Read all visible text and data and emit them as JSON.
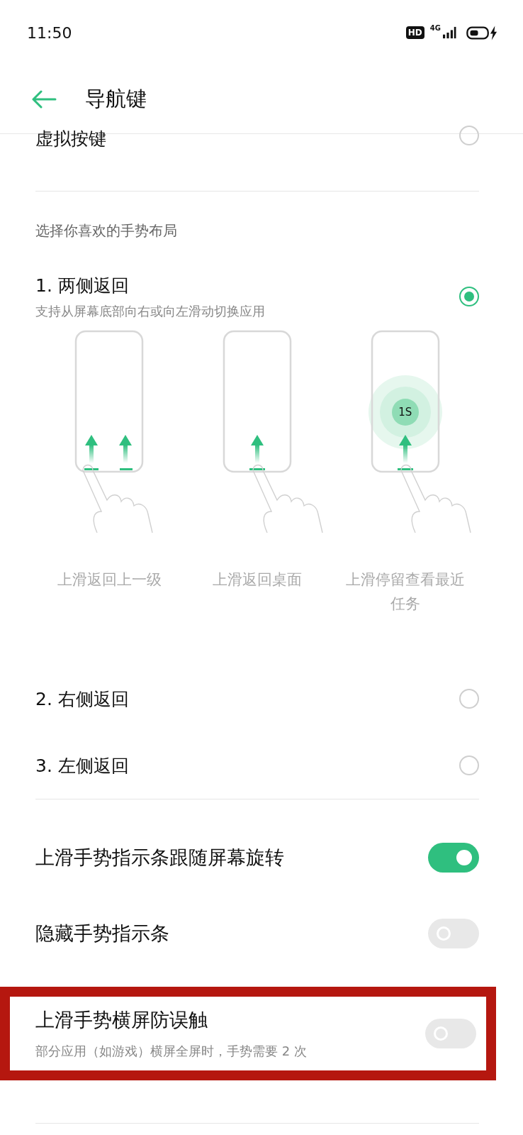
{
  "status_bar": {
    "time": "11:50",
    "hd": "HD",
    "network": "4G"
  },
  "header": {
    "title": "导航键"
  },
  "top_option": {
    "label": "虚拟按键",
    "selected": false
  },
  "section_label": "选择你喜欢的手势布局",
  "layouts": [
    {
      "label": "1. 两侧返回",
      "description": "支持从屏幕底部向右或向左滑动切换应用",
      "selected": true
    },
    {
      "label": "2. 右侧返回",
      "selected": false
    },
    {
      "label": "3. 左侧返回",
      "selected": false
    }
  ],
  "illustrations": [
    {
      "kind": "two-arrows",
      "caption": "上滑返回上一级"
    },
    {
      "kind": "center-arrow",
      "caption": "上滑返回桌面"
    },
    {
      "kind": "hold",
      "badge": "1S",
      "caption": "上滑停留查看最近任务"
    }
  ],
  "toggles": [
    {
      "label": "上滑手势指示条跟随屏幕旋转",
      "on": true
    },
    {
      "label": "隐藏手势指示条",
      "on": false
    },
    {
      "label": "上滑手势横屏防误触",
      "description": "部分应用（如游戏）横屏全屏时，手势需要 2 次",
      "on": false,
      "highlighted": true
    }
  ]
}
